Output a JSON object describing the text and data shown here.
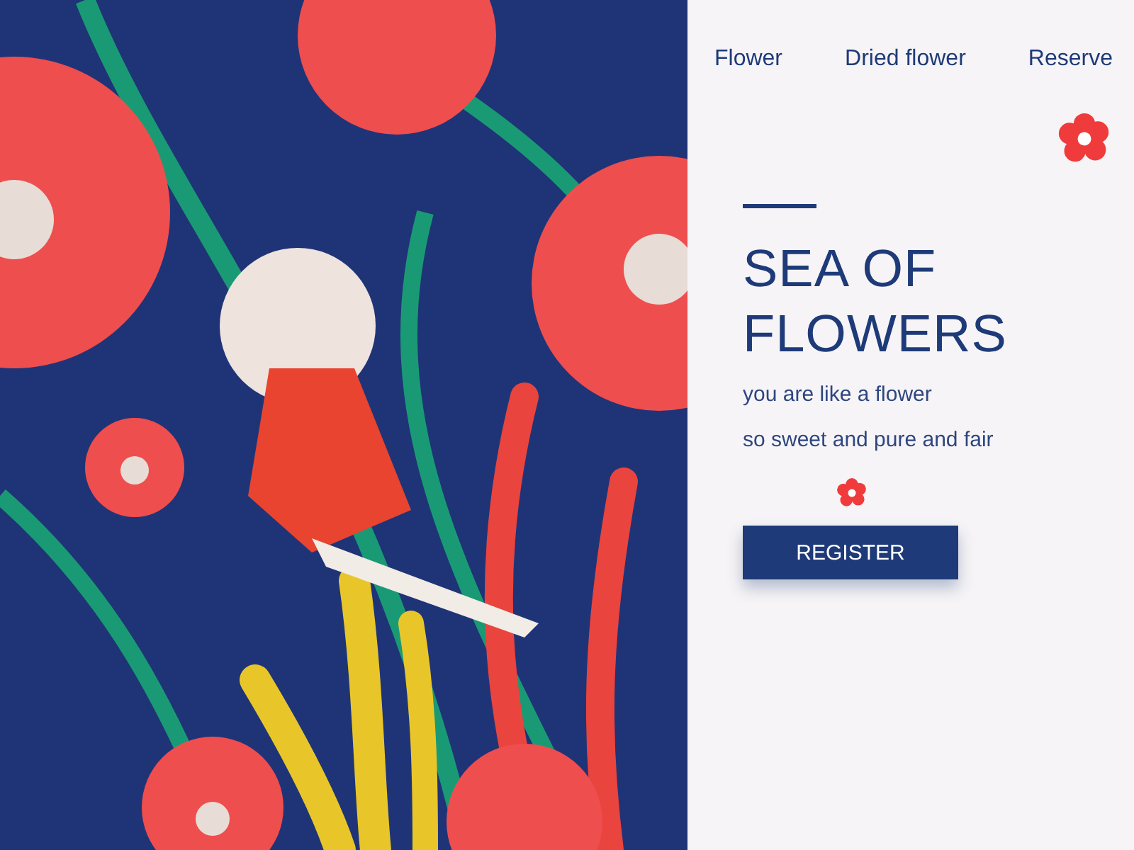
{
  "nav": [
    {
      "label": "Flower"
    },
    {
      "label": "Dried flower"
    },
    {
      "label": "Reserve"
    }
  ],
  "hero": {
    "title": "SEA OF FLOWERS",
    "lines": [
      "you are like a flower",
      "so sweet and pure and fair"
    ],
    "button": "REGISTER"
  }
}
